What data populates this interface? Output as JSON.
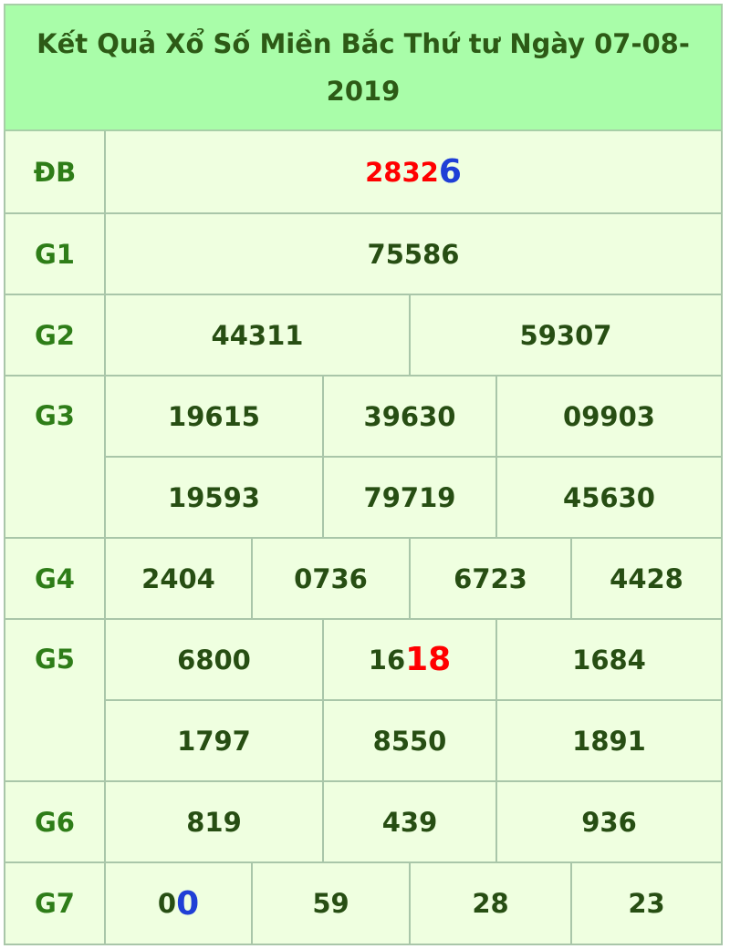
{
  "title": "Kết Quả Xổ Số Miền Bắc Thứ tư Ngày 07-08-2019",
  "labels": {
    "db": "ĐB",
    "g1": "G1",
    "g2": "G2",
    "g3": "G3",
    "g4": "G4",
    "g5": "G5",
    "g6": "G6",
    "g7": "G7"
  },
  "db": {
    "main": "2832",
    "last": "6"
  },
  "g1": [
    "75586"
  ],
  "g2": [
    "44311",
    "59307"
  ],
  "g3": [
    "19615",
    "39630",
    "09903",
    "19593",
    "79719",
    "45630"
  ],
  "g4": [
    "2404",
    "0736",
    "6723",
    "4428"
  ],
  "g5": [
    "6800",
    "1684",
    "1797",
    "8550",
    "1891"
  ],
  "g5_special": {
    "prefix": "16",
    "highlight": "18"
  },
  "g6": [
    "819",
    "439",
    "936"
  ],
  "g7": [
    "59",
    "28",
    "23"
  ],
  "g7_special": {
    "prefix": "0",
    "highlight": "0"
  },
  "colors": {
    "header_bg": "#a9fda9",
    "cell_bg": "#efffe0",
    "text": "#274e13",
    "label": "#2e7d18",
    "highlight_red": "#ff0000",
    "highlight_blue": "#1f3fd6"
  }
}
